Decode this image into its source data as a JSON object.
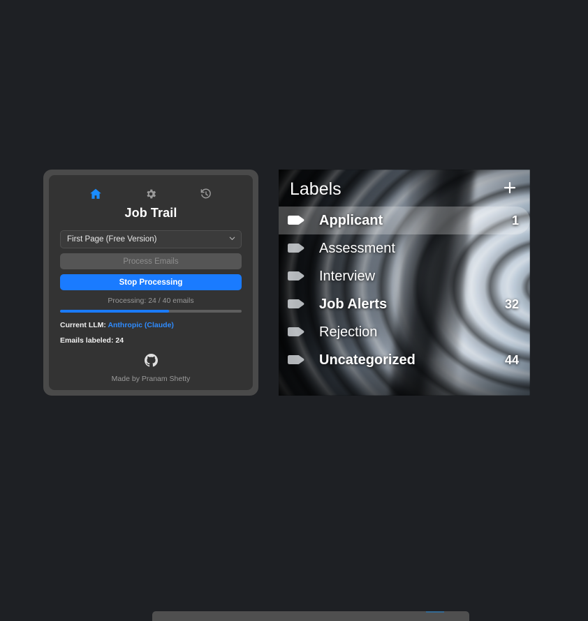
{
  "theme": {
    "page_background": "#1e2024",
    "popup_frame": "#4a4a4a",
    "popup_card": "#333333",
    "accent_blue": "#1a7bff",
    "link_blue": "#2f8cff",
    "muted_text": "#9a9a9a"
  },
  "popup": {
    "nav": [
      {
        "icon": "home-icon",
        "label": "Home",
        "active": true
      },
      {
        "icon": "gear-icon",
        "label": "Settings",
        "active": false
      },
      {
        "icon": "history-icon",
        "label": "History",
        "active": false
      }
    ],
    "title": "Job Trail",
    "page_select": {
      "value": "First Page (Free Version)",
      "chevron": "chevron-down-icon"
    },
    "process_button": {
      "label": "Process Emails",
      "disabled": true
    },
    "stop_button": {
      "label": "Stop Processing",
      "disabled": false
    },
    "progress": {
      "text": "Processing: 24 / 40 emails",
      "current": 24,
      "total": 40,
      "percent": 60
    },
    "status": {
      "llm_prefix": "Current LLM: ",
      "llm_value": "Anthropic (Claude)",
      "labeled_text": "Emails labeled: 24"
    },
    "footer": {
      "icon": "github-icon",
      "credit": "Made by Pranam Shetty"
    }
  },
  "labels_panel": {
    "title": "Labels",
    "add_button": {
      "icon": "plus-icon",
      "label": "Add label"
    },
    "items": [
      {
        "name": "Applicant",
        "count": "1",
        "selected": true,
        "bold": true,
        "icon": "tag-icon"
      },
      {
        "name": "Assessment",
        "count": "",
        "selected": false,
        "bold": false,
        "icon": "tag-icon"
      },
      {
        "name": "Interview",
        "count": "",
        "selected": false,
        "bold": false,
        "icon": "tag-icon"
      },
      {
        "name": "Job Alerts",
        "count": "32",
        "selected": false,
        "bold": true,
        "icon": "tag-icon"
      },
      {
        "name": "Rejection",
        "count": "",
        "selected": false,
        "bold": false,
        "icon": "tag-icon"
      },
      {
        "name": "Uncategorized",
        "count": "44",
        "selected": false,
        "bold": true,
        "icon": "tag-icon"
      }
    ]
  }
}
